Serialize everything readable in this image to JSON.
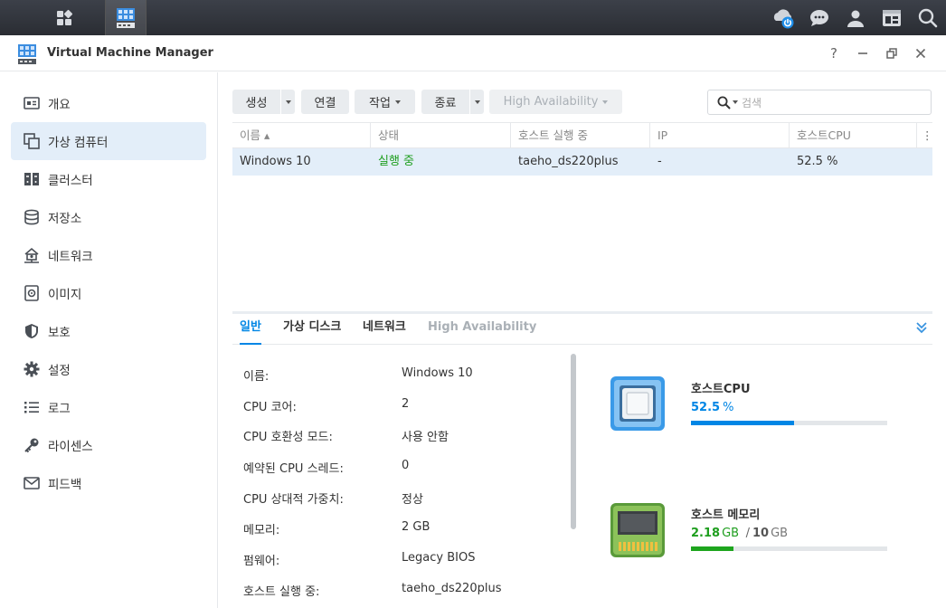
{
  "window": {
    "title": "Virtual Machine Manager"
  },
  "sidebar": {
    "items": [
      {
        "label": "개요",
        "icon": "overview-icon"
      },
      {
        "label": "가상 컴퓨터",
        "icon": "virtual-machine-icon"
      },
      {
        "label": "클러스터",
        "icon": "cluster-icon"
      },
      {
        "label": "저장소",
        "icon": "storage-icon"
      },
      {
        "label": "네트워크",
        "icon": "network-icon"
      },
      {
        "label": "이미지",
        "icon": "image-icon"
      },
      {
        "label": "보호",
        "icon": "shield-icon"
      },
      {
        "label": "설정",
        "icon": "gear-icon"
      },
      {
        "label": "로그",
        "icon": "log-icon"
      },
      {
        "label": "라이센스",
        "icon": "key-icon"
      },
      {
        "label": "피드백",
        "icon": "mail-icon"
      }
    ],
    "active_index": 1
  },
  "toolbar": {
    "create": "생성",
    "connect": "연결",
    "action": "작업",
    "shutdown": "종료",
    "high_availability": "High Availability",
    "search_placeholder": "검색"
  },
  "grid": {
    "columns": [
      "이름 ▴",
      "상태",
      "호스트 실행 중",
      "IP",
      "호스트CPU"
    ],
    "rows": [
      {
        "name": "Windows 10",
        "status": "실행 중",
        "host": "taeho_ds220plus",
        "ip": "-",
        "cpu": "52.5 %"
      }
    ]
  },
  "detail": {
    "tabs": [
      "일반",
      "가상 디스크",
      "네트워크",
      "High Availability"
    ],
    "fields": [
      {
        "label": "이름:",
        "value": "Windows 10"
      },
      {
        "label": "CPU 코어:",
        "value": "2"
      },
      {
        "label": "CPU 호환성 모드:",
        "value": "사용 안함"
      },
      {
        "label": "예약된 CPU 스레드:",
        "value": "0"
      },
      {
        "label": "CPU 상대적 가중치:",
        "value": "정상"
      },
      {
        "label": "메모리:",
        "value": "2 GB"
      },
      {
        "label": "펌웨어:",
        "value": "Legacy BIOS"
      },
      {
        "label": "호스트 실행 중:",
        "value": "taeho_ds220plus"
      }
    ],
    "host_cpu": {
      "title": "호스트CPU",
      "value": "52.5",
      "unit": "%",
      "fraction": 0.525
    },
    "host_memory": {
      "title": "호스트 메모리",
      "used": "2.18",
      "used_unit": "GB",
      "sep": "/",
      "total": "10",
      "total_unit": "GB",
      "fraction": 0.218
    }
  },
  "colors": {
    "accent": "#0086e5",
    "running": "#1e9e1e",
    "memory_bar": "#1ea51e"
  }
}
